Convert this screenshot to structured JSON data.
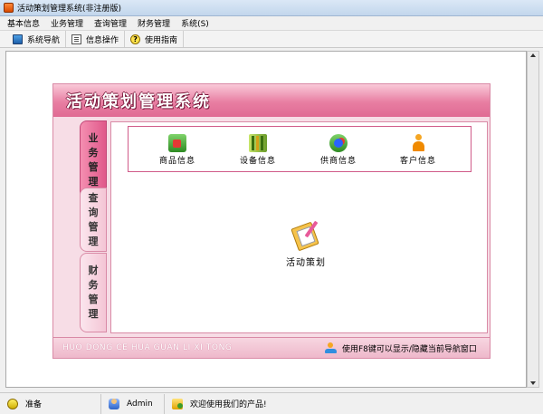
{
  "window": {
    "title": "活动策划管理系统(非注册版)"
  },
  "menu": [
    "基本信息",
    "业务管理",
    "查询管理",
    "财务管理",
    "系统(S)"
  ],
  "toolbar": [
    {
      "label": "系统导航",
      "icon": "navigation-icon"
    },
    {
      "label": "信息操作",
      "icon": "info-operation-icon"
    },
    {
      "label": "使用指南",
      "icon": "help-icon",
      "glyph": "?"
    }
  ],
  "panel": {
    "title": "活动策划管理系统",
    "tabs": [
      {
        "label": "业务管理",
        "active": true
      },
      {
        "label": "查询管理",
        "active": false
      },
      {
        "label": "财务管理",
        "active": false
      }
    ],
    "sub_items": [
      {
        "label": "商品信息",
        "icon": "goods-icon"
      },
      {
        "label": "设备信息",
        "icon": "device-icon"
      },
      {
        "label": "供商信息",
        "icon": "supplier-icon"
      },
      {
        "label": "客户信息",
        "icon": "customer-icon"
      }
    ],
    "center_item": {
      "label": "活动策划",
      "icon": "event-plan-icon"
    },
    "footer_pinyin": "HUO DONG CE HUA GUAN LI XI TONG",
    "footer_hint": "使用F8键可以显示/隐藏当前导航窗口"
  },
  "status": {
    "ready": "准备",
    "user": "Admin",
    "welcome": "欢迎使用我们的产品!"
  },
  "colors": {
    "accent_pink": "#e06a93",
    "panel_bg": "#f7dde6",
    "tab_active": "#e0588a"
  }
}
